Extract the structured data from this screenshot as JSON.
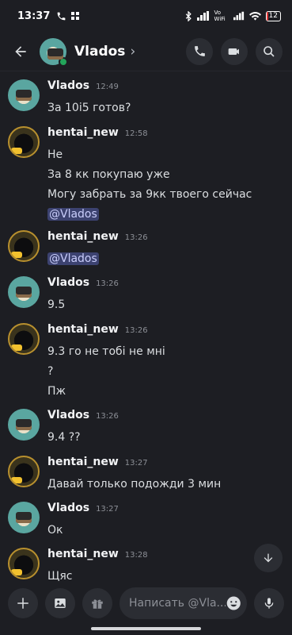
{
  "status_bar": {
    "time": "13:37",
    "battery": "12",
    "network": "Vo WiFi"
  },
  "header": {
    "title": "Vlados",
    "chevron": "›"
  },
  "messages": [
    {
      "author": "Vlados",
      "time": "12:49",
      "avatar": "vlados",
      "lines": [
        "За 10і5 готов?"
      ]
    },
    {
      "author": "hentai_new",
      "time": "12:58",
      "avatar": "hentai",
      "lines": [
        "Не",
        "За 8 кк покупаю уже",
        "Могу забрать за 9кк твоего сейчас",
        "@Vlados"
      ]
    },
    {
      "author": "hentai_new",
      "time": "13:26",
      "avatar": "hentai",
      "lines": [
        "@Vlados"
      ]
    },
    {
      "author": "Vlados",
      "time": "13:26",
      "avatar": "vlados",
      "lines": [
        "9.5"
      ]
    },
    {
      "author": "hentai_new",
      "time": "13:26",
      "avatar": "hentai",
      "lines": [
        "9.3 го не тобі не мні",
        "?",
        "Пж"
      ]
    },
    {
      "author": "Vlados",
      "time": "13:26",
      "avatar": "vlados",
      "lines": [
        "9.4 ??"
      ]
    },
    {
      "author": "hentai_new",
      "time": "13:27",
      "avatar": "hentai",
      "lines": [
        "Давай только подожди 3 мин"
      ]
    },
    {
      "author": "Vlados",
      "time": "13:27",
      "avatar": "vlados",
      "lines": [
        "Ок"
      ]
    },
    {
      "author": "hentai_new",
      "time": "13:28",
      "avatar": "hentai",
      "lines": [
        "Щяс"
      ]
    }
  ],
  "composer": {
    "placeholder": "Написать @Vla..."
  },
  "colors": {
    "background": "#1d1e23",
    "mention_bg": "#3c4270",
    "online": "#23a55a",
    "battery_low": "#e23b3b"
  }
}
